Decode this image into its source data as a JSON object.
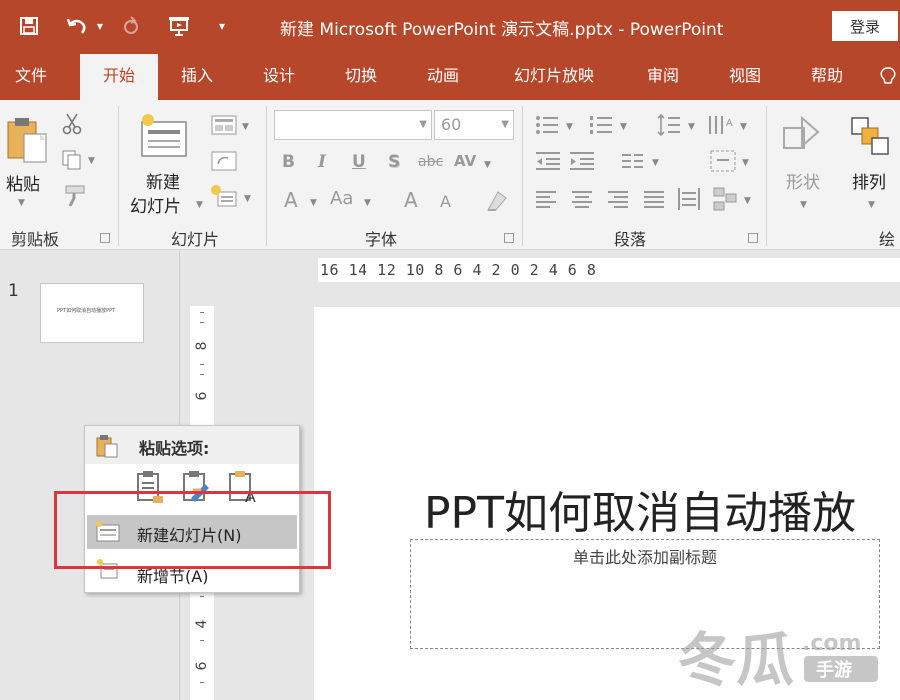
{
  "titlebar": {
    "doc_title": "新建 Microsoft PowerPoint 演示文稿.pptx  -  PowerPoint",
    "login_label": "登录"
  },
  "tabs": [
    {
      "label": "文件"
    },
    {
      "label": "开始"
    },
    {
      "label": "插入"
    },
    {
      "label": "设计"
    },
    {
      "label": "切换"
    },
    {
      "label": "动画"
    },
    {
      "label": "幻灯片放映"
    },
    {
      "label": "审阅"
    },
    {
      "label": "视图"
    },
    {
      "label": "帮助"
    }
  ],
  "ribbon": {
    "clipboard": {
      "group_label": "剪贴板",
      "paste_label": "粘贴"
    },
    "slides": {
      "group_label": "幻灯片",
      "new_slide_line1": "新建",
      "new_slide_line2": "幻灯片"
    },
    "font": {
      "group_label": "字体",
      "font_name": "",
      "font_size": "60",
      "bold": "B",
      "italic": "I",
      "underline": "U",
      "shadow": "S",
      "strike": "abc",
      "spacing": "AV",
      "grow": "A",
      "shrink": "A",
      "case": "Aa",
      "color": "A"
    },
    "paragraph": {
      "group_label": "段落"
    },
    "drawing": {
      "group_label": "绘",
      "shape_label": "形状",
      "arrange_label": "排列"
    }
  },
  "thumbnails": {
    "slide_number": "1",
    "thumb_text": "PPT如何取消自动播放PPT"
  },
  "ruler": {
    "h_text": "16 14 12 10 8 6 4 2 0 2 4 6 8",
    "v_numbers": [
      "8",
      "6",
      "4",
      "6"
    ]
  },
  "slide": {
    "title": "PPT如何取消自动播放",
    "subtitle_placeholder": "单击此处添加副标题"
  },
  "context_menu": {
    "paste_options_label": "粘贴选项:",
    "new_slide_label": "新建幻灯片(N)",
    "new_section_label": "新增节(A)"
  },
  "watermark": {
    "text": "冬瓜",
    "domain": ".com",
    "sub": "手游"
  },
  "colors": {
    "accent": "#b7472a",
    "highlight": "#d9363e",
    "menu_hover": "#c6c6c6"
  }
}
